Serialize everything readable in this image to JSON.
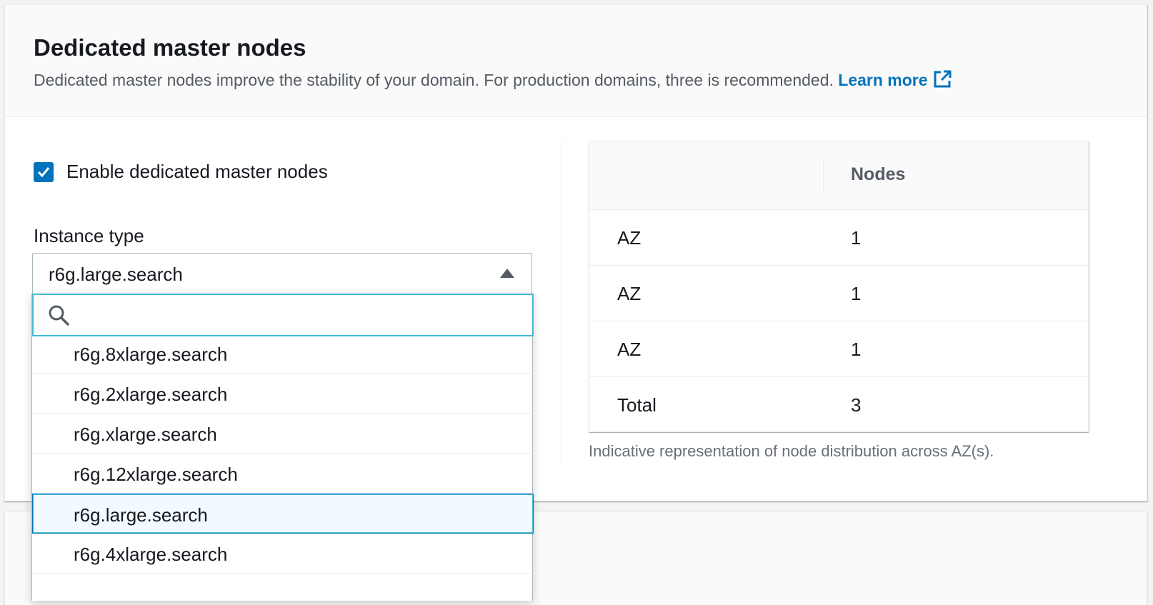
{
  "section": {
    "title": "Dedicated master nodes",
    "description": "Dedicated master nodes improve the stability of your domain. For production domains, three is recommended.",
    "learn_more": "Learn more"
  },
  "enable_checkbox": {
    "label": "Enable dedicated master nodes",
    "checked": true
  },
  "instance_type": {
    "label": "Instance type",
    "selected": "r6g.large.search",
    "search_placeholder": "",
    "options": [
      "r6g.8xlarge.search",
      "r6g.2xlarge.search",
      "r6g.xlarge.search",
      "r6g.12xlarge.search",
      "r6g.large.search",
      "r6g.4xlarge.search"
    ]
  },
  "distribution_table": {
    "column_header": "Nodes",
    "rows": [
      {
        "label": "AZ",
        "nodes": "1"
      },
      {
        "label": "AZ",
        "nodes": "1"
      },
      {
        "label": "AZ",
        "nodes": "1"
      },
      {
        "label": "Total",
        "nodes": "3"
      }
    ],
    "caption": "Indicative representation of node distribution across AZ(s)."
  },
  "colors": {
    "accent": "#0073bb",
    "focus": "#44b9d6",
    "selected_bg": "#f1faff"
  }
}
